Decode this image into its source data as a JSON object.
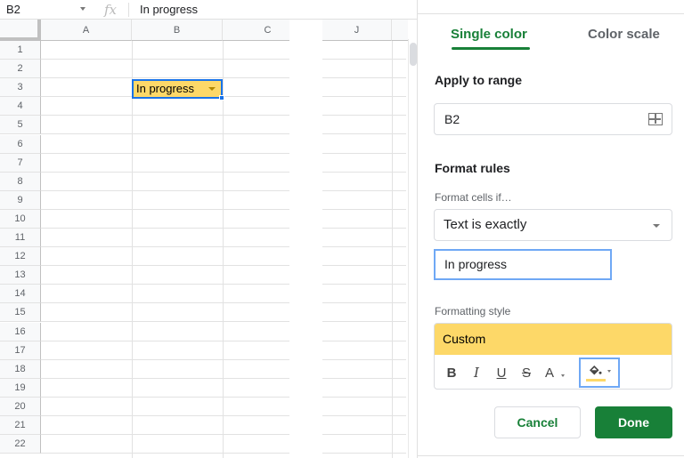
{
  "formula_bar": {
    "cell_ref": "B2",
    "fx_label": "fx",
    "value": "In progress"
  },
  "sheet": {
    "columns": [
      "A",
      "B",
      "C",
      "J"
    ],
    "rows": [
      "1",
      "2",
      "3",
      "4",
      "5",
      "6",
      "7",
      "8",
      "9",
      "10",
      "11",
      "12",
      "13",
      "14",
      "15",
      "16",
      "17",
      "18",
      "19",
      "20",
      "21",
      "22"
    ],
    "selected_cell": {
      "ref": "B2",
      "value": "In progress",
      "fill_color": "#fdd868"
    }
  },
  "panel": {
    "tabs": [
      {
        "label": "Single color",
        "active": true
      },
      {
        "label": "Color scale",
        "active": false
      }
    ],
    "apply_to_range_label": "Apply to range",
    "range_value": "B2",
    "format_rules_label": "Format rules",
    "format_cells_if_label": "Format cells if…",
    "condition": "Text is exactly",
    "condition_value": "In progress",
    "formatting_style_label": "Formatting style",
    "style_preview": "Custom",
    "style_tools": {
      "bold": "B",
      "italic": "I",
      "underline": "U",
      "strikethrough": "S",
      "text_color": "A"
    },
    "fill_color": "#fdd868",
    "cancel_label": "Cancel",
    "done_label": "Done",
    "accent_color": "#188038"
  }
}
